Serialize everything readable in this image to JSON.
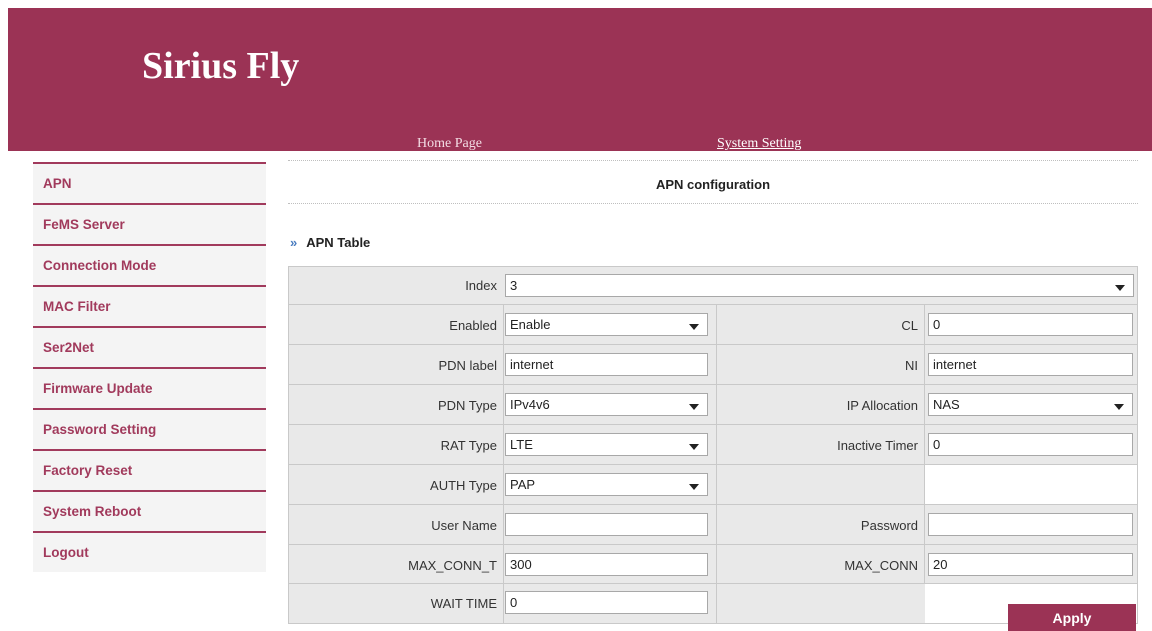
{
  "header": {
    "brand": "Sirius Fly",
    "nav": {
      "home": "Home Page",
      "system": "System Setting"
    }
  },
  "sidebar": {
    "items": [
      {
        "label": "APN"
      },
      {
        "label": "FeMS Server"
      },
      {
        "label": "Connection Mode"
      },
      {
        "label": "MAC Filter"
      },
      {
        "label": "Ser2Net"
      },
      {
        "label": "Firmware Update"
      },
      {
        "label": "Password Setting"
      },
      {
        "label": "Factory Reset"
      },
      {
        "label": "System Reboot"
      },
      {
        "label": "Logout"
      }
    ]
  },
  "main": {
    "section_title": "APN configuration",
    "table_caption": "APN Table",
    "fields": {
      "index": {
        "label": "Index",
        "value": "3"
      },
      "enabled": {
        "label": "Enabled",
        "value": "Enable"
      },
      "cl": {
        "label": "CL",
        "value": "0"
      },
      "pdn_label": {
        "label": "PDN label",
        "value": "internet"
      },
      "ni": {
        "label": "NI",
        "value": "internet"
      },
      "pdn_type": {
        "label": "PDN Type",
        "value": "IPv4v6"
      },
      "ip_allocation": {
        "label": "IP Allocation",
        "value": "NAS"
      },
      "rat_type": {
        "label": "RAT Type",
        "value": "LTE"
      },
      "inactive_timer": {
        "label": "Inactive Timer",
        "value": "0"
      },
      "auth_type": {
        "label": "AUTH Type",
        "value": "PAP"
      },
      "user_name": {
        "label": "User Name",
        "value": ""
      },
      "password": {
        "label": "Password",
        "value": ""
      },
      "max_conn_t": {
        "label": "MAX_CONN_T",
        "value": "300"
      },
      "max_conn": {
        "label": "MAX_CONN",
        "value": "20"
      },
      "wait_time": {
        "label": "WAIT TIME",
        "value": "0"
      }
    },
    "apply_label": "Apply"
  },
  "colors": {
    "brand": "#9b3355",
    "accent_text": "#a13a5c",
    "table_bg": "#e9e9e9"
  }
}
